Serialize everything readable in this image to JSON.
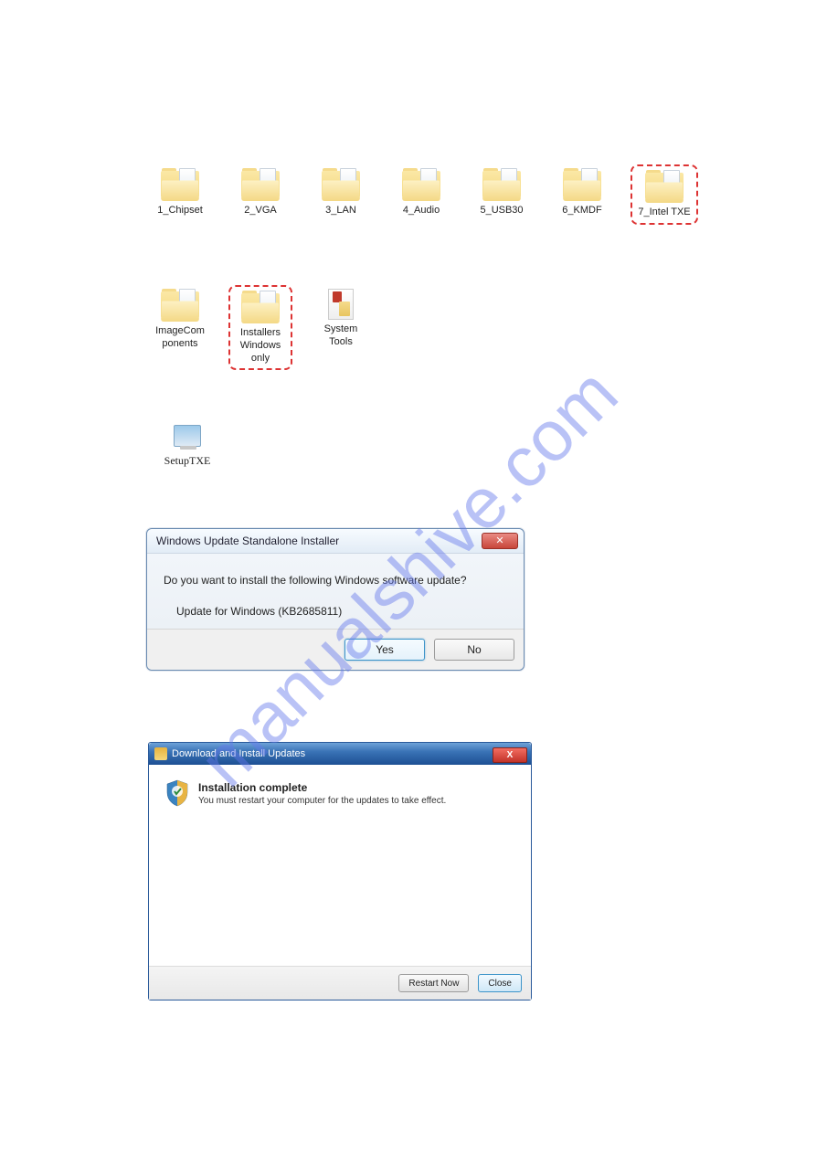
{
  "watermark": "manualshive.com",
  "folders_row1": [
    {
      "label": "1_Chipset"
    },
    {
      "label": "2_VGA"
    },
    {
      "label": "3_LAN"
    },
    {
      "label": "4_Audio"
    },
    {
      "label": "5_USB30"
    },
    {
      "label": "6_KMDF"
    },
    {
      "label": "7_Intel TXE",
      "highlight": true
    }
  ],
  "folders_row2": [
    {
      "label": "ImageCom\nponents"
    },
    {
      "label": "Installers\nWindows\nonly",
      "highlight": true
    },
    {
      "label": "System\nTools",
      "systools": true
    }
  ],
  "setup_txe_label": "SetupTXE",
  "dialog1": {
    "title": "Windows Update Standalone Installer",
    "question": "Do you want to install the following Windows software update?",
    "update_name": "Update for Windows (KB2685811)",
    "yes": "Yes",
    "no": "No"
  },
  "dialog2": {
    "title": "Download and Install Updates",
    "heading": "Installation complete",
    "sub": "You must restart your computer for the updates to take effect.",
    "restart": "Restart Now",
    "close": "Close"
  }
}
